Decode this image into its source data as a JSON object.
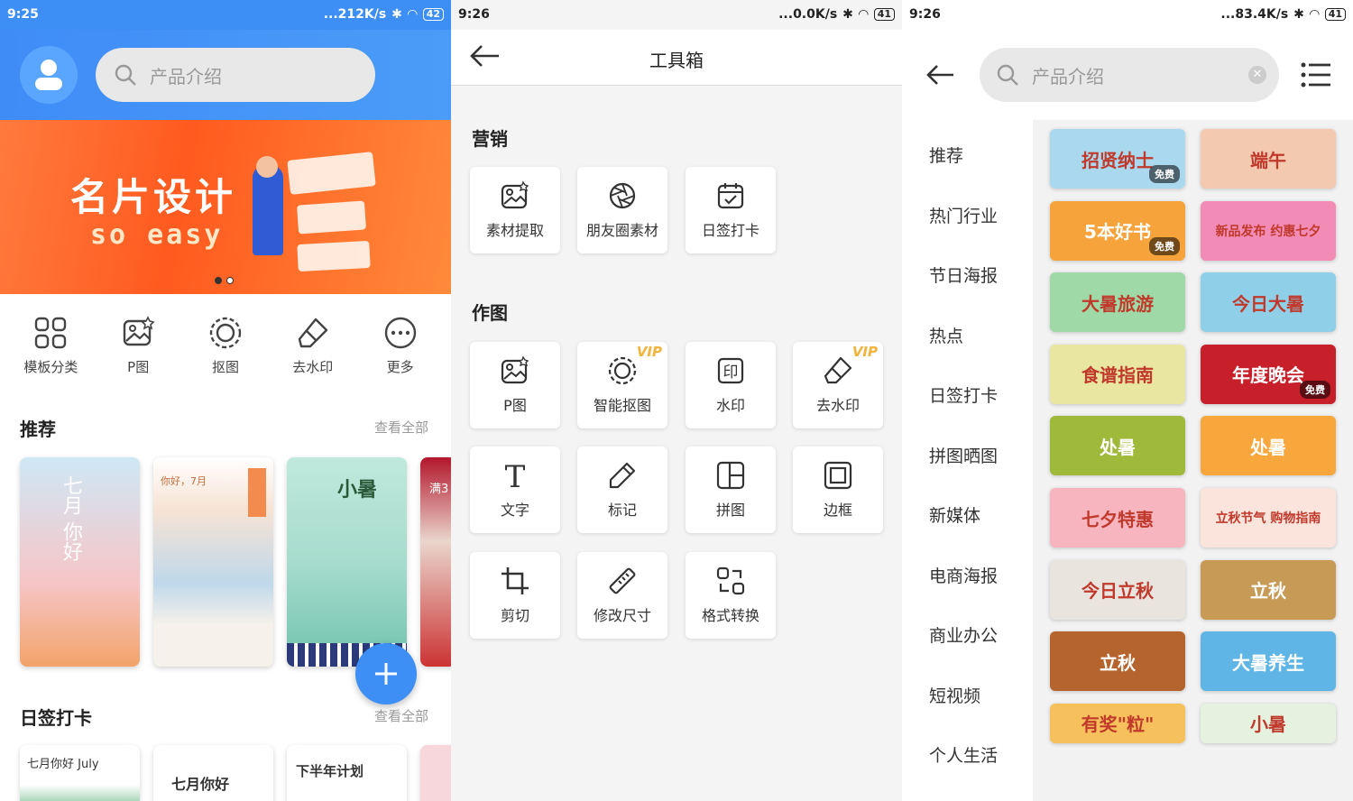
{
  "screen1": {
    "status": {
      "time": "9:25",
      "net": "...212K/s",
      "battery": "42"
    },
    "search_placeholder": "产品介绍",
    "banner": {
      "title": "名片设计",
      "subtitle": "so easy"
    },
    "quick": [
      {
        "label": "模板分类",
        "icon": "grid-icon"
      },
      {
        "label": "P图",
        "icon": "photo-edit-icon"
      },
      {
        "label": "抠图",
        "icon": "cutout-icon"
      },
      {
        "label": "去水印",
        "icon": "eraser-icon"
      },
      {
        "label": "更多",
        "icon": "more-icon"
      }
    ],
    "recommend": {
      "title": "推荐",
      "see_all": "查看全部",
      "cards": [
        {
          "text": "七月 你好"
        },
        {
          "text": "你好，7月"
        },
        {
          "text": "小暑"
        },
        {
          "text": "满3"
        }
      ]
    },
    "daily": {
      "title": "日签打卡",
      "see_all": "查看全部",
      "cards": [
        {
          "text": "七月你好 July"
        },
        {
          "text": "七月你好"
        },
        {
          "text": "下半年计划"
        }
      ]
    }
  },
  "screen2": {
    "status": {
      "time": "9:26",
      "net": "...0.0K/s",
      "battery": "41"
    },
    "title": "工具箱",
    "groups": [
      {
        "name": "营销",
        "tools": [
          {
            "label": "素材提取",
            "icon": "image-extract-icon"
          },
          {
            "label": "朋友圈素材",
            "icon": "aperture-icon"
          },
          {
            "label": "日签打卡",
            "icon": "calendar-check-icon"
          }
        ]
      },
      {
        "name": "作图",
        "tools": [
          {
            "label": "P图",
            "icon": "photo-edit-icon"
          },
          {
            "label": "智能抠图",
            "icon": "cutout-icon",
            "badge": "VIP"
          },
          {
            "label": "水印",
            "icon": "stamp-icon"
          },
          {
            "label": "去水印",
            "icon": "eraser-icon",
            "badge": "VIP"
          },
          {
            "label": "文字",
            "icon": "text-icon"
          },
          {
            "label": "标记",
            "icon": "pen-icon"
          },
          {
            "label": "拼图",
            "icon": "collage-icon"
          },
          {
            "label": "边框",
            "icon": "frame-icon"
          },
          {
            "label": "剪切",
            "icon": "crop-icon"
          },
          {
            "label": "修改尺寸",
            "icon": "ruler-icon"
          },
          {
            "label": "格式转换",
            "icon": "convert-icon"
          }
        ]
      }
    ]
  },
  "screen3": {
    "status": {
      "time": "9:26",
      "net": "...83.4K/s",
      "battery": "41"
    },
    "search_placeholder": "产品介绍",
    "categories": [
      "推荐",
      "热门行业",
      "节日海报",
      "热点",
      "日签打卡",
      "拼图晒图",
      "新媒体",
      "电商海报",
      "商业办公",
      "短视频",
      "个人生活"
    ],
    "thumbs": [
      {
        "text": "招贤纳士",
        "badge": "免费",
        "color": "#a9d8ef"
      },
      {
        "text": "端午",
        "color": "#f3c9b0"
      },
      {
        "text": "5本好书",
        "badge": "免费",
        "color": "#f6a33b"
      },
      {
        "text": "新品发布 约惠七夕",
        "color": "#f28bb5"
      },
      {
        "text": "大暑旅游",
        "color": "#9fd9a7"
      },
      {
        "text": "今日大暑",
        "color": "#8fd0e8"
      },
      {
        "text": "食谱指南",
        "color": "#e8e6a0"
      },
      {
        "text": "年度晚会",
        "badge": "免费",
        "color": "#c8202b"
      },
      {
        "text": "处暑",
        "color": "#9fb93a"
      },
      {
        "text": "处暑",
        "color": "#f7a73b"
      },
      {
        "text": "七夕特惠",
        "color": "#f7b5c0"
      },
      {
        "text": "立秋节气 购物指南",
        "color": "#fbe4dc"
      },
      {
        "text": "今日立秋",
        "color": "#e9e4de"
      },
      {
        "text": "立秋",
        "color": "#c79a56"
      },
      {
        "text": "立秋",
        "color": "#b4642c"
      },
      {
        "text": "大暑养生",
        "color": "#5fb6e6"
      },
      {
        "text": "有奖\"粒\"",
        "color": "#f6c15c"
      },
      {
        "text": "小暑",
        "color": "#e5f2e0"
      }
    ]
  }
}
